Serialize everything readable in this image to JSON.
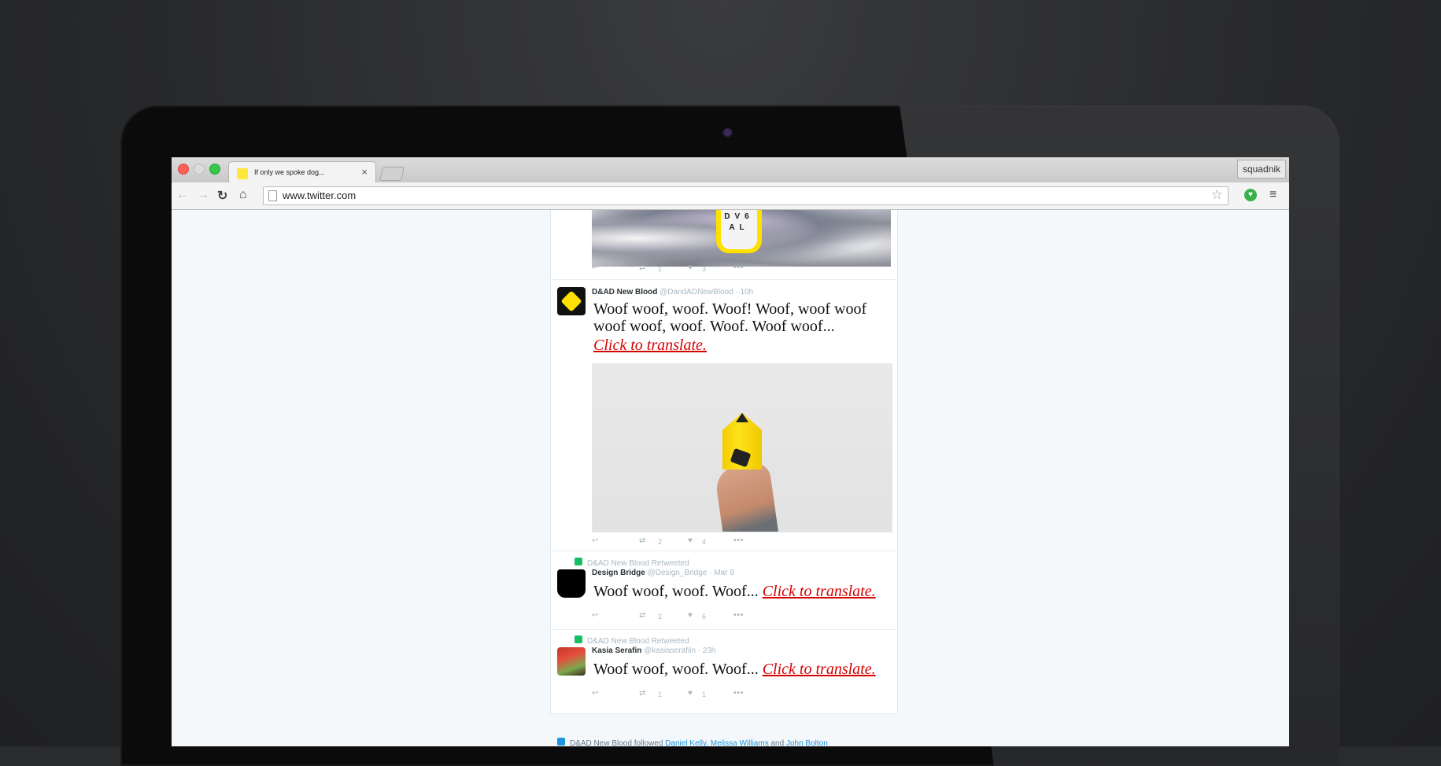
{
  "browser": {
    "tab_title": "If only we spoke dog...",
    "tab_close": "×",
    "profile_name": "squadnik",
    "url": "www.twitter.com",
    "icons": {
      "back": "←",
      "forward": "→",
      "reload": "↻",
      "home": "⌂",
      "star": "☆",
      "menu": "≡",
      "extension": "♥"
    }
  },
  "feed": {
    "top_tweet": {
      "media_badge_text": "DV6 AL",
      "retweets": "1",
      "likes": "3"
    },
    "tweets": [
      {
        "name": "D&AD New Blood",
        "handle": "@DandADNewBlood",
        "time": "· 10h",
        "text_line1": "Woof woof, woof. Woof! Woof, woof woof",
        "text_line2": "woof woof, woof. Woof. Woof woof...",
        "translate": "Click to translate.",
        "retweets": "2",
        "likes": "4"
      },
      {
        "retweeted_by": "D&AD New Blood Retweeted",
        "name": "Design Bridge",
        "handle": "@Design_Bridge",
        "time": "· Mar 9",
        "text": "Woof woof, woof. Woof...",
        "translate": "Click to translate.",
        "retweets": "2",
        "likes": "6"
      },
      {
        "retweeted_by": "D&AD New Blood Retweeted",
        "name": "Kasia Serafin",
        "handle": "@kasiaserafiin",
        "time": "· 23h",
        "text": "Woof woof, woof. Woof...",
        "translate": "Click to translate.",
        "retweets": "1",
        "likes": "1"
      }
    ],
    "followed_line": {
      "prefix": "D&AD New Blood followed",
      "person1": "Daniel Kelly",
      "sep": ",",
      "person2": "Melissa Williams",
      "and": "and",
      "person3": "John Bolton"
    },
    "action_icons": {
      "reply": "↩",
      "retweet": "⇄",
      "like": "♥",
      "more": "•••"
    }
  }
}
